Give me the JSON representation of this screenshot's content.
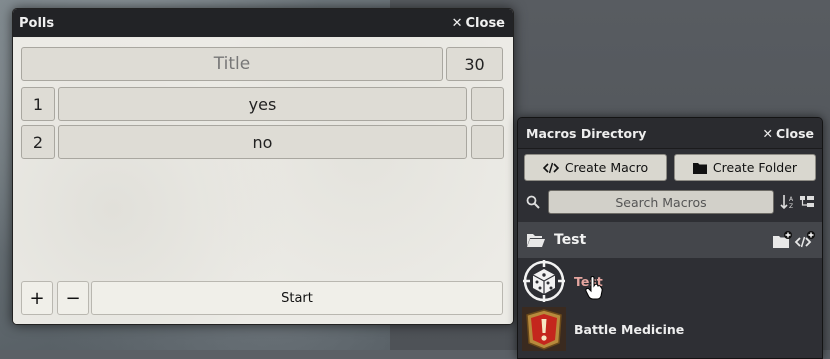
{
  "polls": {
    "title": "Polls",
    "close_label": "Close",
    "poll_title_placeholder": "Title",
    "duration_value": "30",
    "options": [
      {
        "index": "1",
        "text": "yes",
        "checkbox": ""
      },
      {
        "index": "2",
        "text": "no",
        "checkbox": ""
      }
    ],
    "add_label": "+",
    "remove_label": "−",
    "start_label": "Start"
  },
  "macros": {
    "title": "Macros Directory",
    "close_label": "Close",
    "create_macro_label": "Create Macro",
    "create_folder_label": "Create Folder",
    "search_placeholder": "Search Macros",
    "folder": {
      "name": "Test"
    },
    "items": [
      {
        "name": "Test",
        "icon": "dice-icon"
      },
      {
        "name": "Battle Medicine",
        "icon": "alert-badge-icon"
      }
    ]
  },
  "colors": {
    "window_header": "#222326",
    "polls_body": "#ecebe6",
    "macros_panel": "#2e2f34",
    "macro_test_name": "#e6a6a0",
    "battle_medicine_badge": "#c4261d"
  }
}
